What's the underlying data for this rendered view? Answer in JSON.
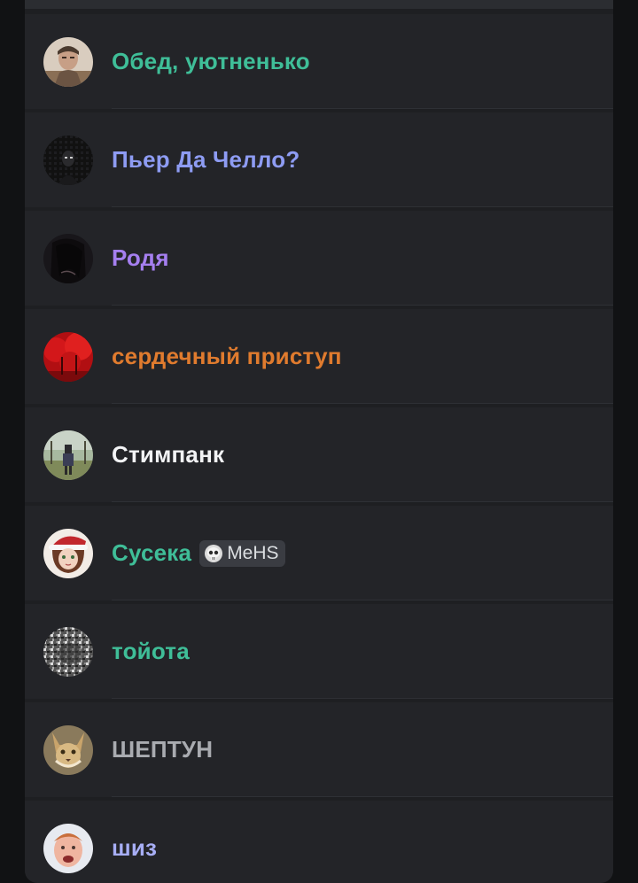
{
  "members": [
    {
      "name": "Обед, уютненько",
      "color": "#3fbe98",
      "avatar_icon": "person-portrait-avatar-icon"
    },
    {
      "name": "Пьер Да Челло?",
      "color": "#8e9cf3",
      "avatar_icon": "dark-figure-avatar-icon"
    },
    {
      "name": "Родя",
      "color": "#a57ff0",
      "avatar_icon": "dark-hair-avatar-icon"
    },
    {
      "name": "сердечный приступ",
      "color": "#e07b2e",
      "avatar_icon": "red-forest-avatar-icon"
    },
    {
      "name": "Стимпанк",
      "color": "#f2f3f5",
      "avatar_icon": "outdoor-scene-avatar-icon"
    },
    {
      "name": "Сусека",
      "color": "#3fbe98",
      "avatar_icon": "santa-hat-girl-avatar-icon",
      "tag": {
        "icon": "skull-icon",
        "label": "MeHS"
      }
    },
    {
      "name": "тойота",
      "color": "#3fbe98",
      "avatar_icon": "noise-texture-avatar-icon"
    },
    {
      "name": "ШЕПТУН",
      "color": "#a9abb0",
      "avatar_icon": "lynx-avatar-icon"
    },
    {
      "name": "шиз",
      "color": "#a7aef5",
      "avatar_icon": "face-photo-avatar-icon"
    }
  ]
}
